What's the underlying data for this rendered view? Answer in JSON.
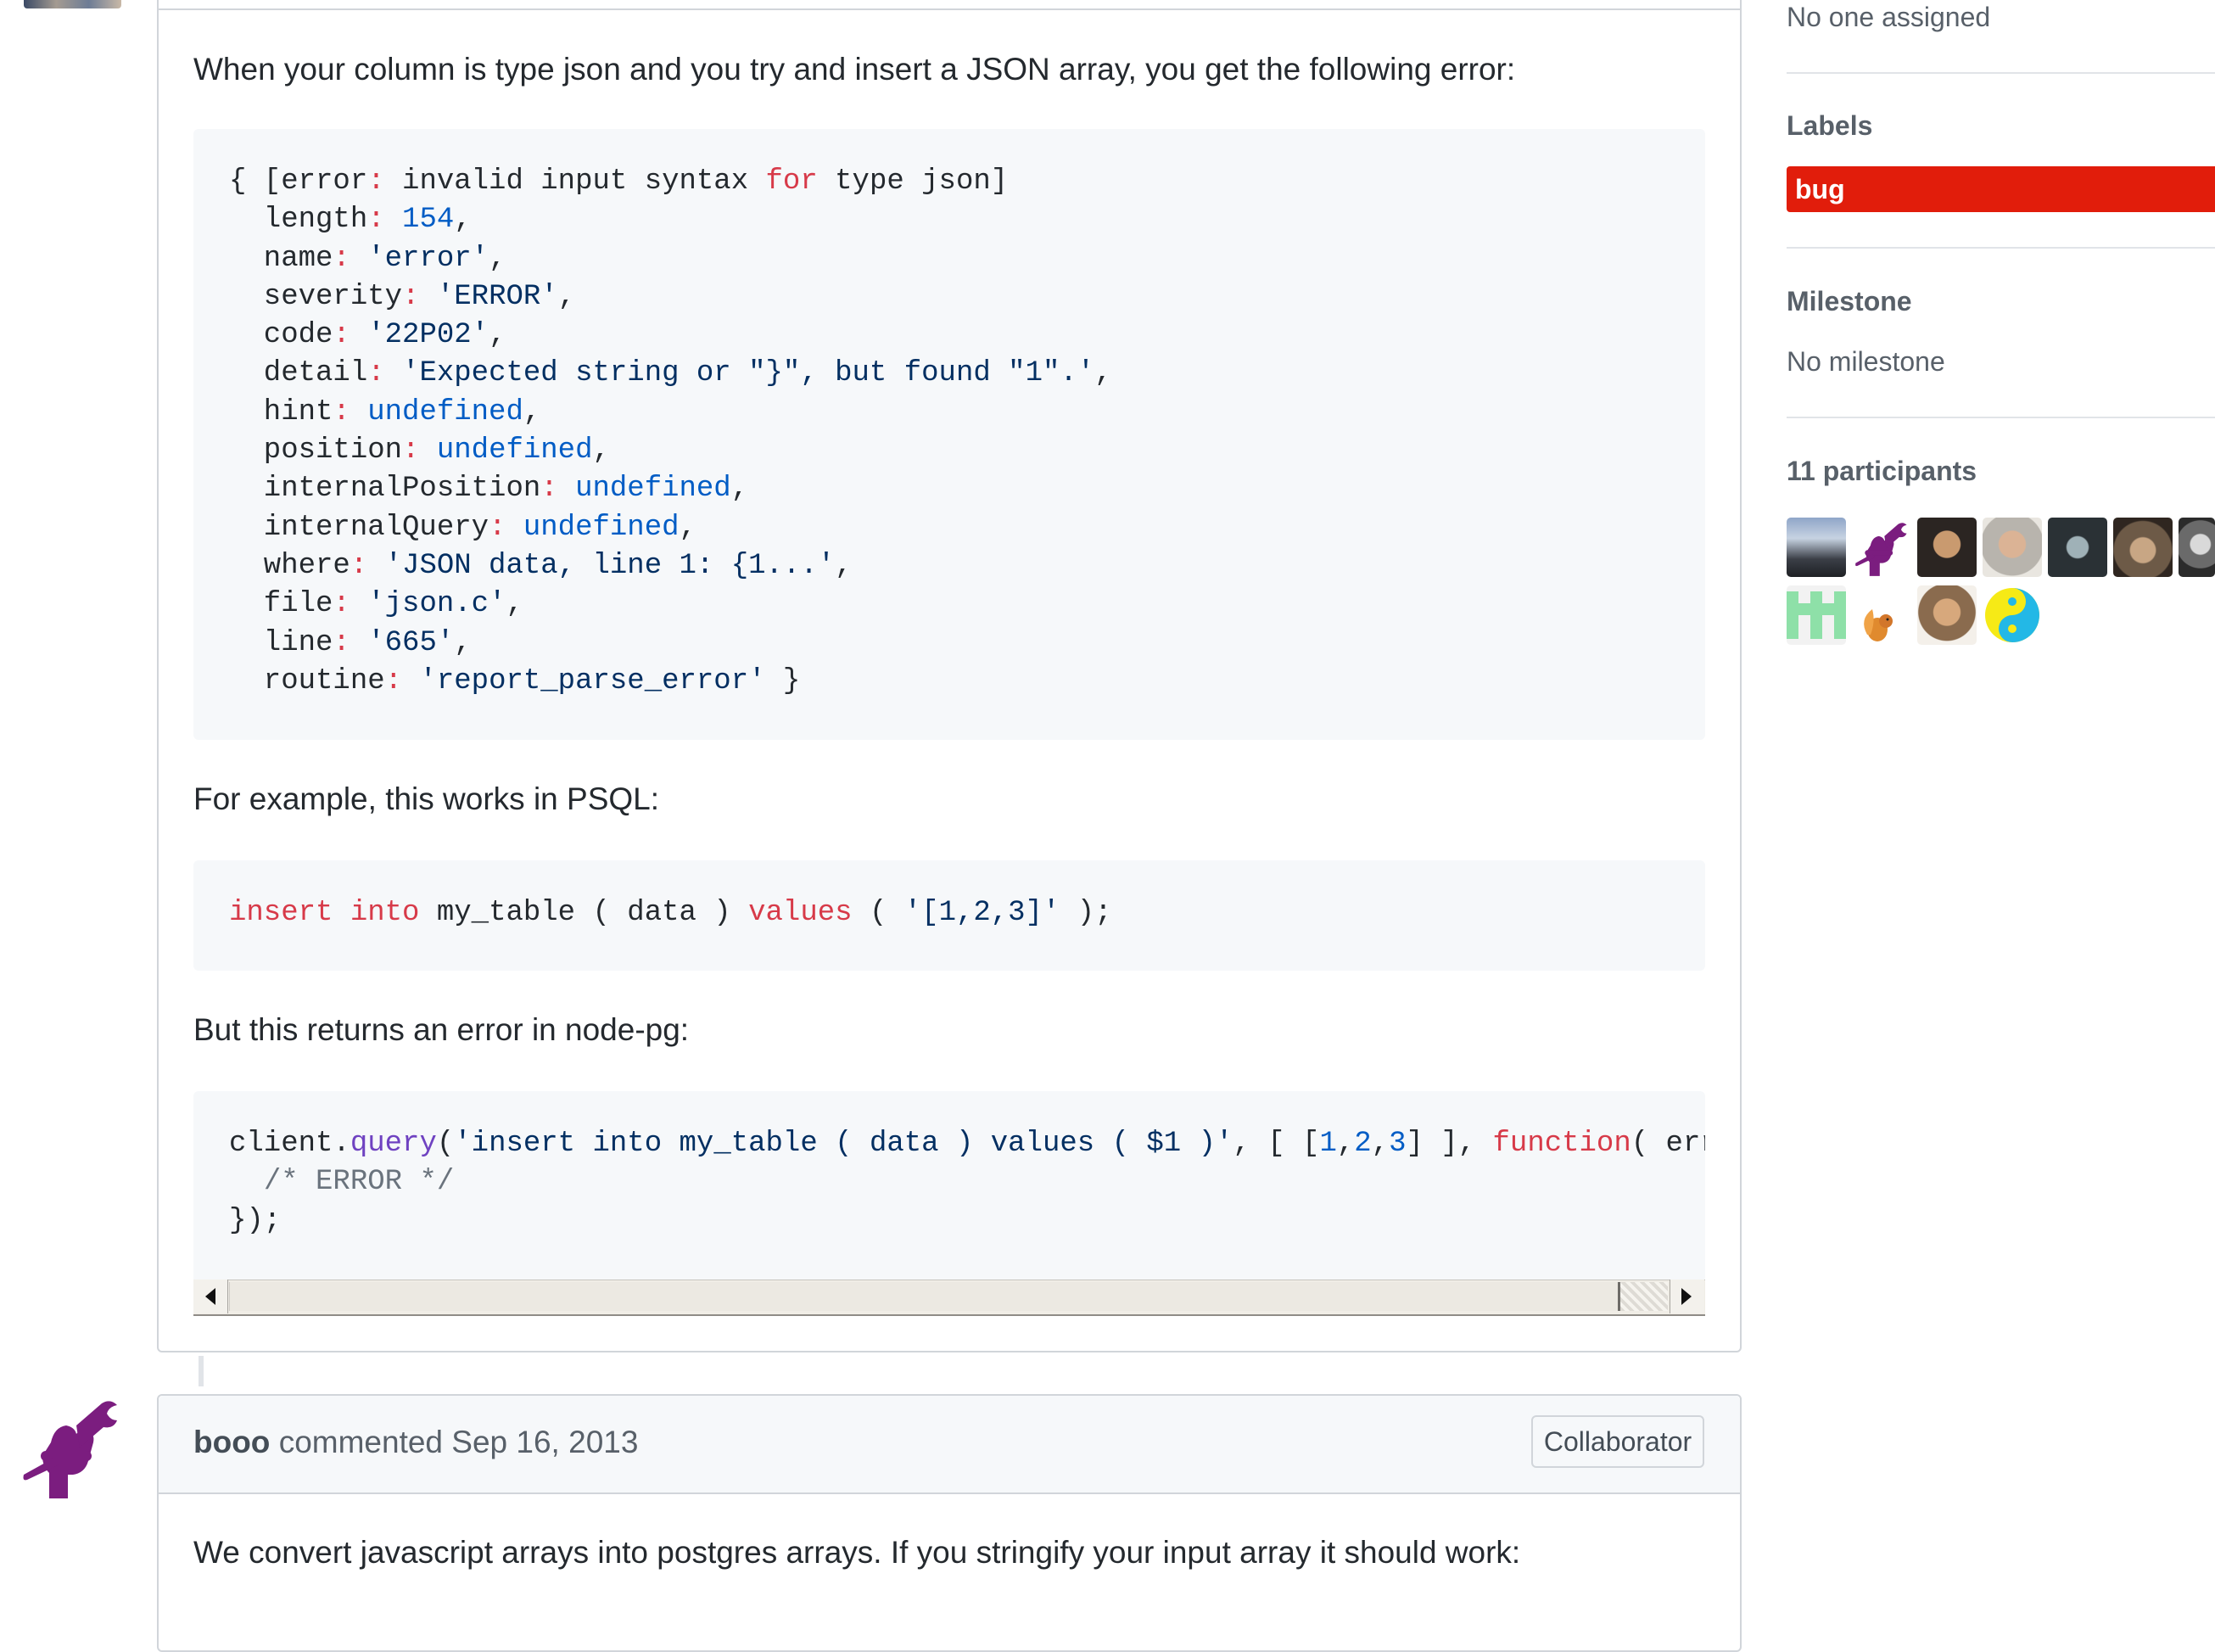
{
  "comment1": {
    "intro": "When your column is type json and you try and insert a JSON array, you get the following error:",
    "example_intro": "For example, this works in PSQL:",
    "error_intro": "But this returns an error in node-pg:"
  },
  "comment2": {
    "author": "booo",
    "action": "commented",
    "date": "Sep 16, 2013",
    "badge": "Collaborator",
    "body": "We convert javascript arrays into postgres arrays. If you stringify your input array it should work:"
  },
  "sidebar": {
    "assignees_value": "No one assigned",
    "labels_heading": "Labels",
    "label_bug": "bug",
    "milestone_heading": "Milestone",
    "milestone_value": "No milestone",
    "participants_heading": "11 participants"
  },
  "colors": {
    "bug_label": "#e11d0b",
    "keyword": "#d73a49",
    "number": "#005cc5",
    "string": "#032f62",
    "function": "#6f42c1",
    "comment": "#6a737d"
  },
  "icons": {
    "collaborator_avatar": "raised-fist-wrench-icon",
    "participant_avatars": [
      "photo",
      "raised-fist-wrench-icon",
      "photo",
      "photo",
      "photo",
      "photo",
      "photo",
      "identicon",
      "squirrel-icon",
      "photo",
      "yin-yang-icon"
    ]
  }
}
